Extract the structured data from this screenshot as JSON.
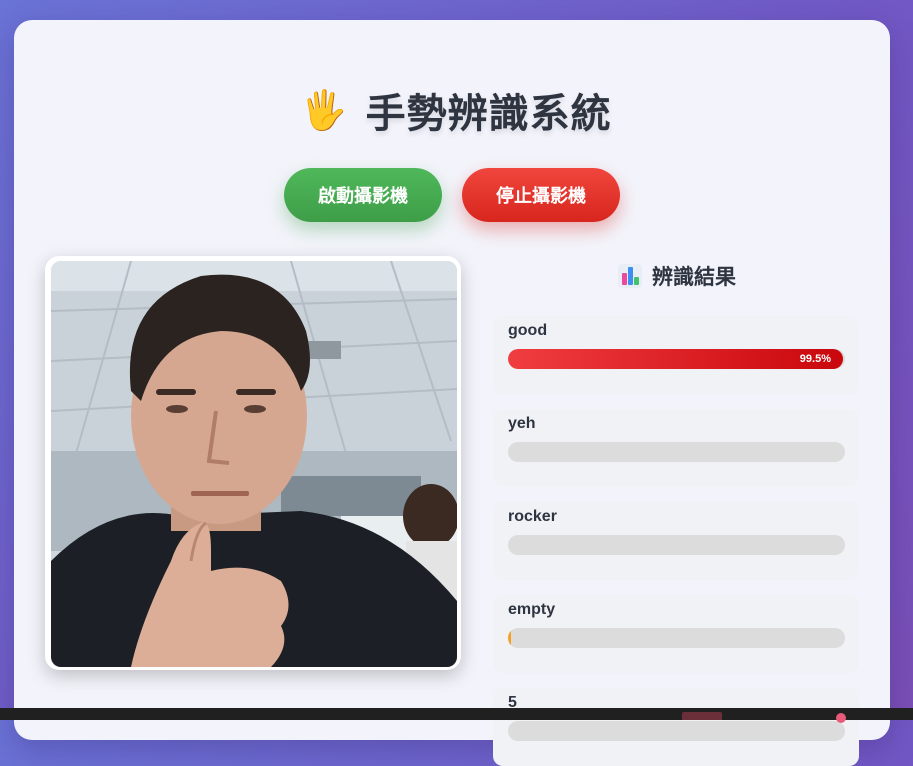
{
  "header": {
    "emoji": "🖐️",
    "title": "手勢辨識系統"
  },
  "controls": {
    "start_label": "啟動攝影機",
    "stop_label": "停止攝影機"
  },
  "camera": {
    "feed_icon": "webcam-feed-image"
  },
  "results": {
    "heading": "辨識結果",
    "heading_icon": "bar-chart-icon",
    "items": [
      {
        "label": "good",
        "percent_text": "99.5%",
        "value": 99.5
      },
      {
        "label": "yeh",
        "percent_text": "",
        "value": 0
      },
      {
        "label": "rocker",
        "percent_text": "",
        "value": 0
      },
      {
        "label": "empty",
        "percent_text": "",
        "value": 1
      },
      {
        "label": "5",
        "percent_text": "",
        "value": 0
      }
    ]
  },
  "colors": {
    "start_button": "#44a74f",
    "stop_button": "#e2332a",
    "top_bar": "#d7161c",
    "low_bar": "#f5a027",
    "background_gradient_start": "#6a73d6",
    "background_gradient_end": "#7a4fb6"
  }
}
